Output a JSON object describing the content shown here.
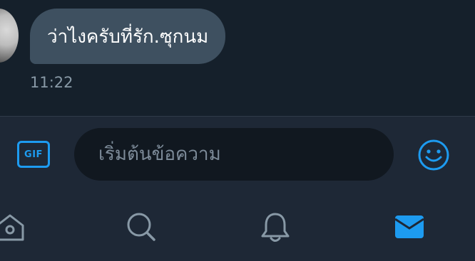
{
  "conversation": {
    "messages": [
      {
        "text": "ว่าไงครับที่รัก.ซุกนม",
        "time": "11:22",
        "direction": "incoming",
        "avatar": "user-avatar"
      }
    ]
  },
  "composer": {
    "gif_label": "GIF",
    "input_placeholder": "เริ่มต้นข้อความ",
    "input_value": "",
    "emoji_icon": "smiley-face-icon"
  },
  "nav": {
    "items": [
      {
        "icon": "home-icon",
        "active": false
      },
      {
        "icon": "search-icon",
        "active": false
      },
      {
        "icon": "bell-icon",
        "active": false
      },
      {
        "icon": "envelope-icon",
        "active": true
      }
    ]
  },
  "colors": {
    "background": "#15202b",
    "bar_background": "#1e2836",
    "bubble": "#3e5060",
    "accent": "#1d9bf0",
    "muted_text": "#8899a6",
    "inactive_icon": "#8899a6"
  }
}
